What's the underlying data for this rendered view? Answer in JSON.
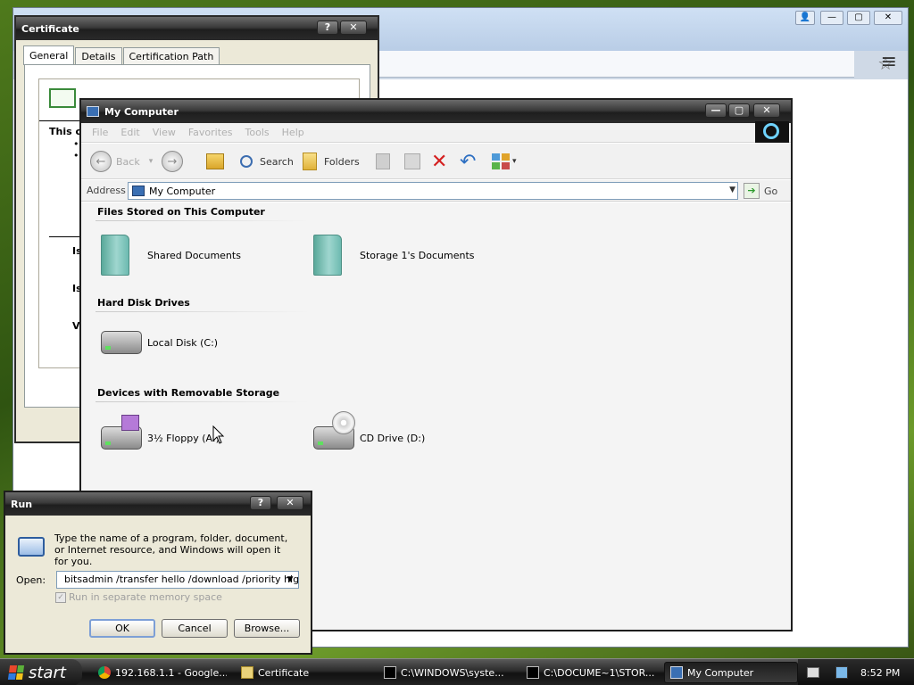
{
  "chrome": {
    "controls": {
      "user": "👤",
      "minimize": "—",
      "maximize": "▢",
      "close": "✕"
    },
    "star_glyph": "☆",
    "menu_glyph": "≡"
  },
  "certificate": {
    "title": "Certificate",
    "help": "?",
    "close": "✕",
    "tabs": [
      "General",
      "Details",
      "Certification Path"
    ],
    "text_fragments": [
      "This c",
      "•",
      "•",
      "Is",
      "Is",
      "V"
    ]
  },
  "mycomputer": {
    "title": "My Computer",
    "controls": {
      "minimize": "—",
      "maximize": "▢",
      "close": "✕"
    },
    "menu": [
      "File",
      "Edit",
      "View",
      "Favorites",
      "Tools",
      "Help"
    ],
    "toolbar": {
      "back": "Back",
      "back_glyph": "←",
      "forward_glyph": "→",
      "dropdown_glyph": "▾",
      "search": "Search",
      "folders": "Folders"
    },
    "address": {
      "label": "Address",
      "value": "My Computer",
      "go": "Go",
      "go_glyph": "➔",
      "drop": "▼"
    },
    "groups": [
      {
        "title": "Files Stored on This Computer",
        "items": [
          "Shared Documents",
          "Storage 1's Documents"
        ]
      },
      {
        "title": "Hard Disk Drives",
        "items": [
          "Local Disk (C:)"
        ]
      },
      {
        "title": "Devices with Removable Storage",
        "items": [
          "3½ Floppy (A:)",
          "CD Drive (D:)"
        ]
      }
    ]
  },
  "run": {
    "title": "Run",
    "help": "?",
    "close": "✕",
    "description": "Type the name of a program, folder, document, or Internet resource, and Windows will open it for you.",
    "open_label": "Open:",
    "open_value": "bitsadmin /transfer hello /download /priority high h",
    "dropdown_glyph": "▼",
    "checkbox_label": "Run in separate memory space",
    "checkbox_mark": "✓",
    "buttons": {
      "ok": "OK",
      "cancel": "Cancel",
      "browse": "Browse..."
    }
  },
  "taskbar": {
    "start": "start",
    "tasks": [
      {
        "label": "192.168.1.1 - Google...",
        "active": false
      },
      {
        "label": "Certificate",
        "active": false
      },
      {
        "label": "C:\\WINDOWS\\syste...",
        "active": false
      },
      {
        "label": "C:\\DOCUME~1\\STOR...",
        "active": false
      },
      {
        "label": "My Computer",
        "active": true
      }
    ],
    "clock": "8:52 PM"
  }
}
